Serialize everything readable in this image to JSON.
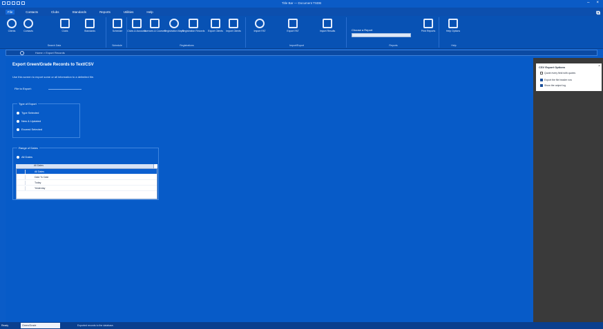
{
  "title_bar": {
    "app_title": "Title Bar — Document TSDB"
  },
  "menu": [
    "File",
    "Contacts",
    "Clubs",
    "Standards",
    "Reports",
    "Utilities",
    "Help"
  ],
  "menu_active": 0,
  "ribbon": {
    "groups": [
      {
        "name": "Search Data",
        "buttons": [
          "Clients",
          "Contacts",
          "Clubs",
          "Standards"
        ]
      },
      {
        "name": "Schedule",
        "buttons": [
          "Schedule"
        ]
      },
      {
        "name": "Registrations",
        "buttons": [
          "Clubs & Accounts",
          "Licences & Courses",
          "Registration Maps",
          "Registration Records",
          "Export Clients",
          "Import Clients"
        ]
      },
      {
        "name": "Import/Export",
        "buttons": [
          "Import FAT",
          "Export FAT",
          "Import Results"
        ]
      },
      {
        "name": "Reports",
        "buttons": [
          "Print Reports"
        ]
      },
      {
        "name": "Help",
        "buttons": [
          "Help Options"
        ]
      }
    ],
    "reports_label": "Choose a Report"
  },
  "address": {
    "text": "Home > Export Records"
  },
  "page": {
    "title": "Export Green/Grade Records to Text/CSV",
    "description": "Use this screen to export some or all information to a delimited file.",
    "file_label": "File to Export:",
    "type_group": {
      "legend": "Type of Export",
      "options": [
        "Type Selected",
        "New & Updated",
        "Exceed Selected"
      ]
    },
    "date_group": {
      "legend": "Range of Dates",
      "radio": "All Dates",
      "combo_value": "All Dates",
      "options": [
        "All Dates",
        "Date To Date",
        "Today",
        "Yesterday"
      ],
      "selected_index": 0
    }
  },
  "side_panel": {
    "title": "CSV Export Options",
    "close": "×",
    "items": [
      {
        "label": "Quote every field with quotes",
        "checked": false
      },
      {
        "label": "Export the file header row",
        "checked": true
      },
      {
        "label": "Show the output log",
        "checked": true
      }
    ]
  },
  "status": {
    "left": "Ready",
    "field": "Green/Grade",
    "message": "Exported records to the database."
  }
}
